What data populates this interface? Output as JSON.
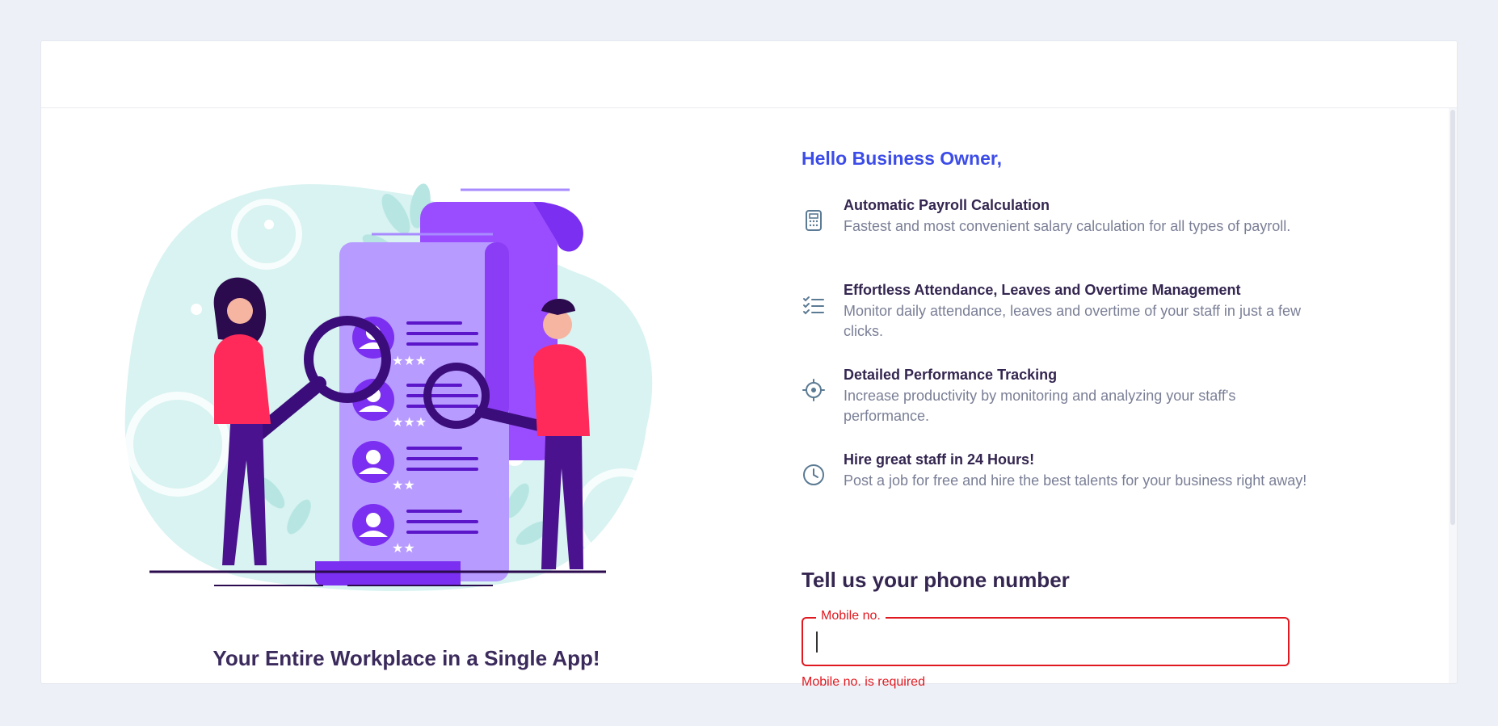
{
  "left": {
    "tagline": "Your Entire Workplace in a Single App!"
  },
  "right": {
    "greeting": "Hello Business Owner,",
    "features": [
      {
        "icon": "calculator-icon",
        "title": "Automatic Payroll Calculation",
        "description": "Fastest and most convenient salary calculation for all types of payroll."
      },
      {
        "icon": "checklist-icon",
        "title": "Effortless Attendance, Leaves and Overtime Management",
        "description": "Monitor daily attendance, leaves and overtime of your staff in just a few clicks."
      },
      {
        "icon": "target-icon",
        "title": "Detailed Performance Tracking",
        "description": "Increase productivity by monitoring and analyzing your staff's performance."
      },
      {
        "icon": "clock-icon",
        "title": "Hire great staff in 24 Hours!",
        "description": "Post a job for free and hire the best talents for your business right away!"
      }
    ],
    "phone_heading": "Tell us your phone number",
    "mobile_field": {
      "label": "Mobile no.",
      "value": "",
      "error": "Mobile no. is required"
    }
  },
  "colors": {
    "accent": "#3c4ce8",
    "heading": "#342650",
    "error": "#e0181f",
    "purple": "#7b2ff0",
    "pink": "#ff2a5a",
    "mint": "#d8f3f1"
  }
}
